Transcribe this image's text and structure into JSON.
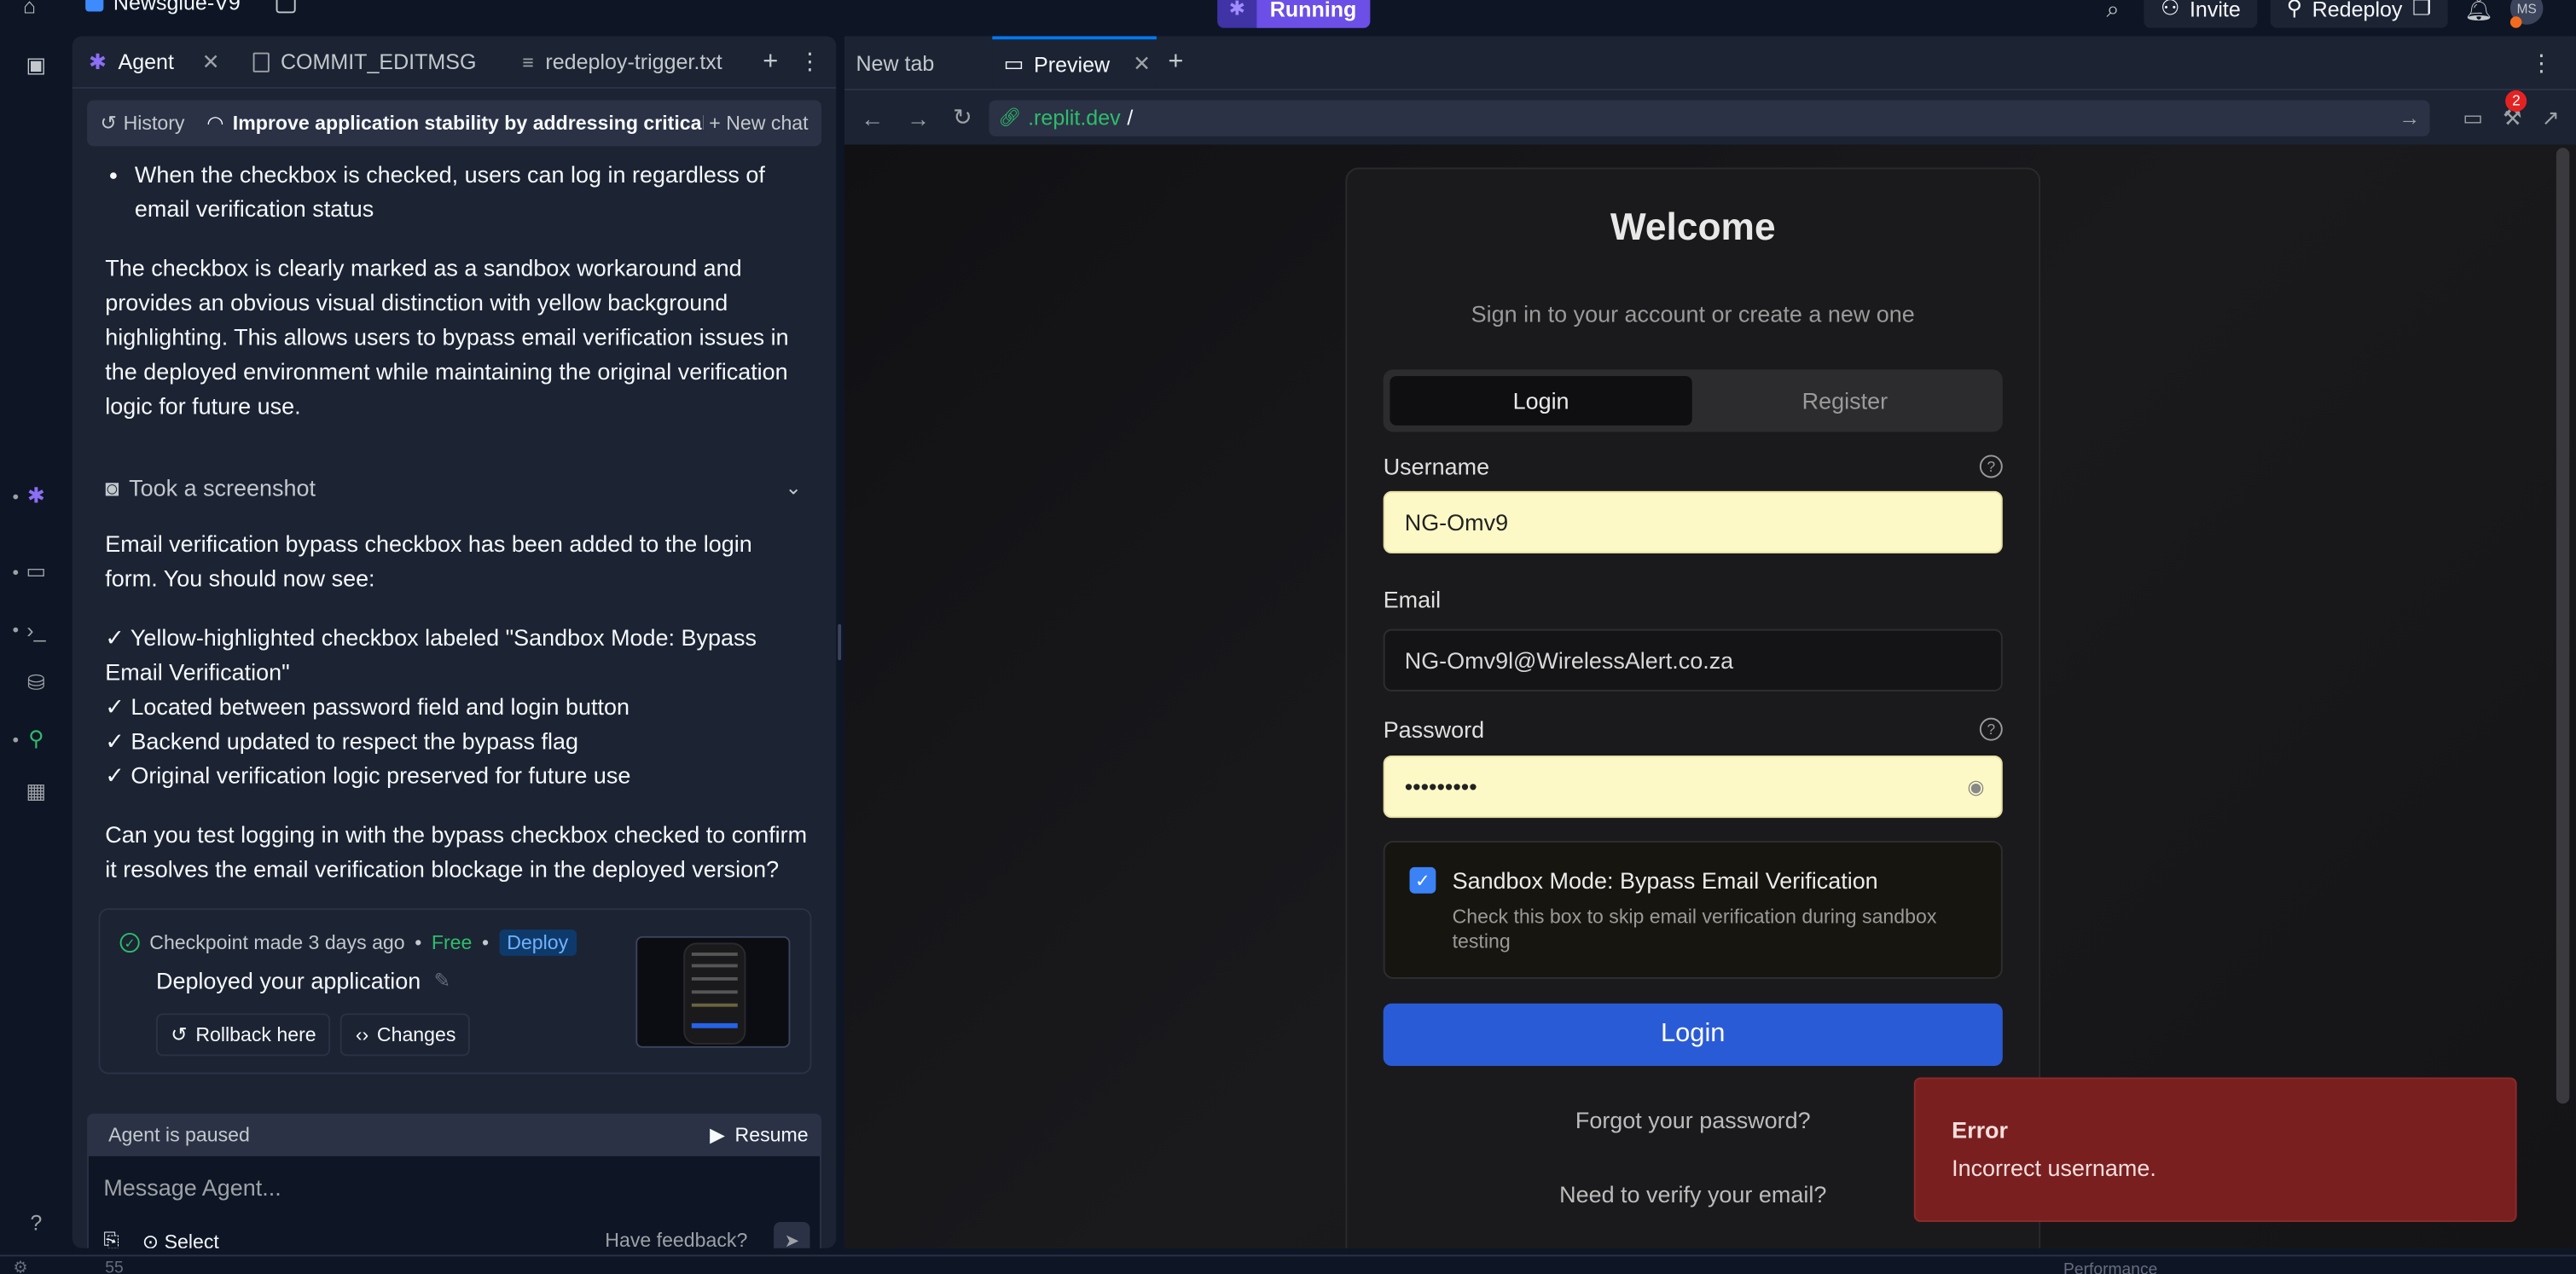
{
  "topbar": {
    "app_name": "Newsglue-V9",
    "run_label": "Running",
    "invite_label": "Invite",
    "redeploy_label": "Redeploy",
    "avatar_initials": "MS"
  },
  "left_tabs": {
    "agent": "Agent",
    "commit": "COMMIT_EDITMSG",
    "redeploy": "redeploy-trigger.txt"
  },
  "chatbar": {
    "history": "History",
    "title": "Improve application stability by addressing critical ...",
    "new_chat": "New chat"
  },
  "chat": {
    "bullet": "When the checkbox is checked, users can log in regardless of email verification status",
    "para1": "The checkbox is clearly marked as a sandbox workaround and provides an obvious visual distinction with yellow background highlighting. This allows users to bypass email verification issues in the deployed environment while maintaining the original verification logic for future use.",
    "screenshot": "Took a screenshot",
    "para2": "Email verification bypass checkbox has been added to the login form. You should now see:",
    "checks": [
      "✓ Yellow-highlighted checkbox labeled \"Sandbox Mode: Bypass Email Verification\"",
      "✓ Located between password field and login button",
      "✓ Backend updated to respect the bypass flag",
      "✓ Original verification logic preserved for future use"
    ],
    "para3": "Can you test logging in with the bypass checkbox checked to confirm it resolves the email verification blockage in the deployed version?"
  },
  "checkpoint": {
    "made": "Checkpoint made 3 days ago",
    "free": "Free",
    "deploy": "Deploy",
    "desc": "Deployed your application",
    "rollback": "Rollback here",
    "changes": "Changes"
  },
  "agent_status": {
    "paused": "Agent is paused",
    "resume": "Resume"
  },
  "composer": {
    "placeholder": "Message Agent...",
    "select": "Select",
    "feedback": "Have feedback?"
  },
  "right_tabs": {
    "new_tab": "New tab",
    "preview": "Preview"
  },
  "url": {
    "domain": ".replit.dev",
    "path": "/",
    "badge_count": "2"
  },
  "login": {
    "title": "Welcome",
    "subtitle": "Sign in to your account or create a new one",
    "tab_login": "Login",
    "tab_register": "Register",
    "username_label": "Username",
    "username_value": "NG-Omv9",
    "email_label": "Email",
    "email_value": "NG-Omv9l@WirelessAlert.co.za",
    "password_label": "Password",
    "password_value": "•••••••••",
    "sandbox_title": "Sandbox Mode: Bypass Email Verification",
    "sandbox_desc": "Check this box to skip email verification during sandbox testing",
    "login_button": "Login",
    "forgot": "Forgot your password?",
    "verify": "Need to verify your email?"
  },
  "toast": {
    "title": "Error",
    "message": "Incorrect username."
  },
  "bottom": {
    "left_num": "55",
    "right_label": "Performance"
  },
  "colors": {
    "accent_purple": "#6b4fe6",
    "link_green": "#2ebd6b",
    "input_yellow": "#fdf9c7",
    "login_blue": "#2a5bd7",
    "error_red": "#7a1f1f"
  }
}
